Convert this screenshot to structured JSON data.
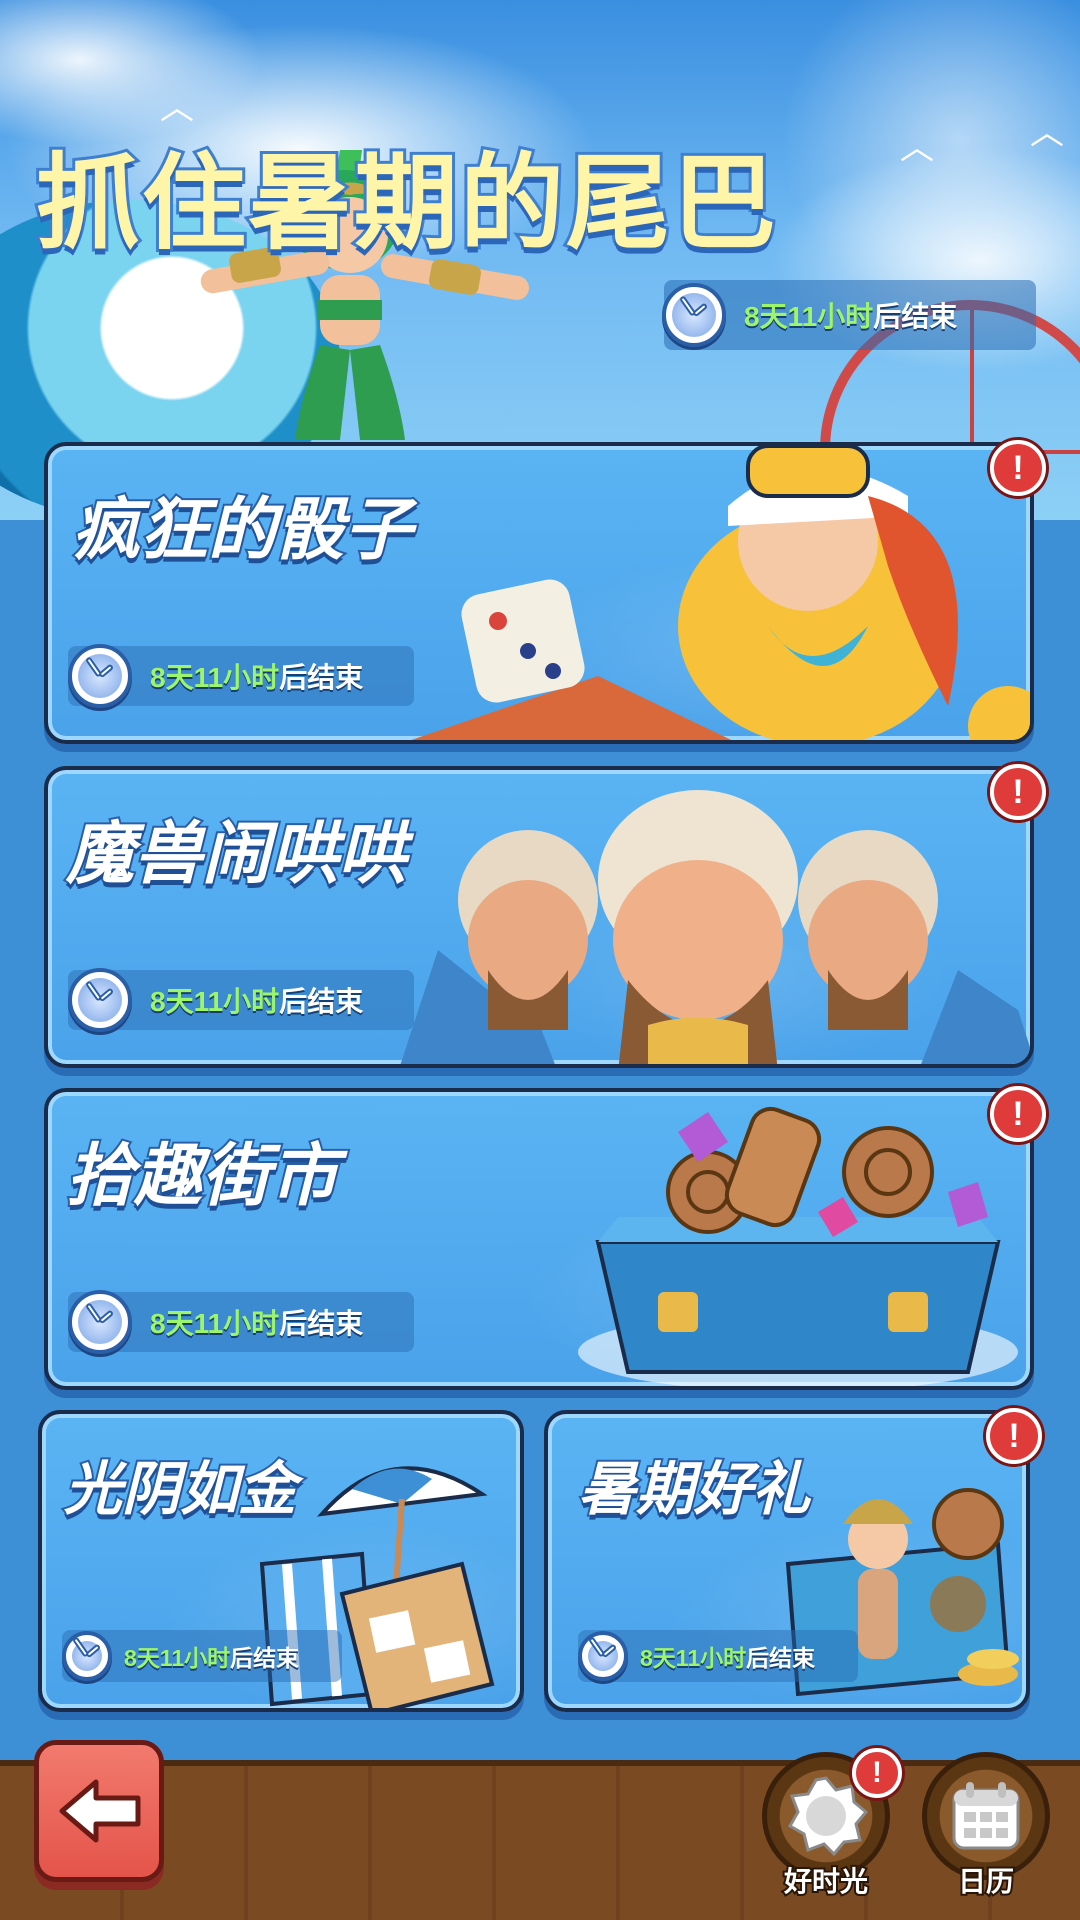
{
  "banner": {
    "title": "抓住暑期的尾巴",
    "timer_days": "8天11小时",
    "timer_suffix": "后结束"
  },
  "cards": [
    {
      "title": "疯狂的骰子",
      "timer_days": "8天11小时",
      "timer_suffix": "后结束",
      "alert": "!"
    },
    {
      "title": "魔兽闹哄哄",
      "timer_days": "8天11小时",
      "timer_suffix": "后结束",
      "alert": "!"
    },
    {
      "title": "拾趣街市",
      "timer_days": "8天11小时",
      "timer_suffix": "后结束",
      "alert": "!"
    },
    {
      "title": "光阴如金",
      "timer_days": "8天11小时",
      "timer_suffix": "后结束"
    },
    {
      "title": "暑期好礼",
      "timer_days": "8天11小时",
      "timer_suffix": "后结束",
      "alert": "!"
    }
  ],
  "bottom": {
    "good_time_label": "好时光",
    "good_time_alert": "!",
    "calendar_label": "日历"
  },
  "colors": {
    "title_yellow": "#fff5a8",
    "timer_green": "#9cf56c",
    "alert_red": "#e03b3b",
    "card_blue": "#4aa2ea",
    "wood_brown": "#7a4a22",
    "back_button_red": "#e4544a"
  },
  "icons": [
    "clock-icon",
    "alert-icon",
    "dice-icon",
    "back-arrow-icon",
    "sun-badge-icon",
    "calendar-icon",
    "umbrella-icon",
    "chest-icon"
  ]
}
